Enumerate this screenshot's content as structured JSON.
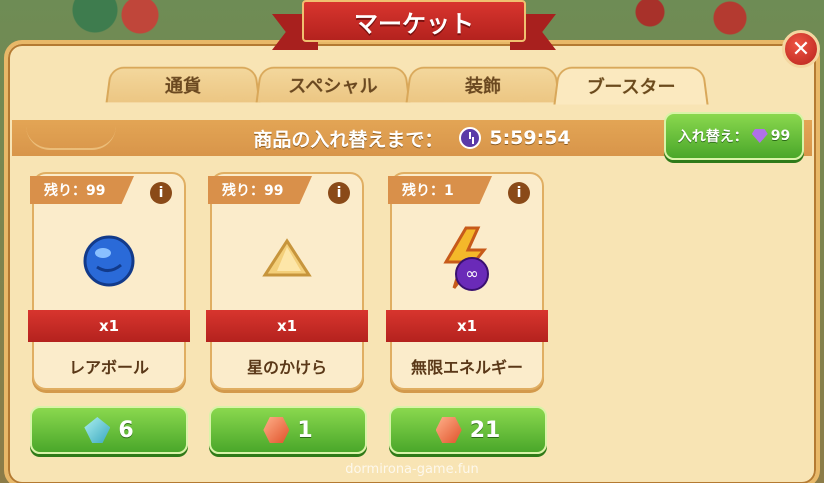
{
  "title": "マーケット",
  "close_label": "✕",
  "tabs": [
    {
      "label": "通貨",
      "active": false
    },
    {
      "label": "スペシャル",
      "active": false
    },
    {
      "label": "装飾",
      "active": false
    },
    {
      "label": "ブースター",
      "active": true
    }
  ],
  "timer": {
    "label": "商品の入れ替えまで：",
    "time": "5:59:54"
  },
  "refresh": {
    "label": "入れ替え：",
    "cost": "99",
    "icon": "purple-gem-icon"
  },
  "items": [
    {
      "remain": "残り：99",
      "qty": "x1",
      "name": "レアボール",
      "price": "6",
      "currency": "blue-crystal",
      "icon": "rare-ball-icon"
    },
    {
      "remain": "残り：99",
      "qty": "x1",
      "name": "星のかけら",
      "price": "1",
      "currency": "orange-gem",
      "icon": "star-fragment-icon"
    },
    {
      "remain": "残り：1",
      "qty": "x1",
      "name": "無限エネルギー",
      "price": "21",
      "currency": "orange-gem",
      "icon": "infinite-energy-icon"
    }
  ],
  "info_label": "i",
  "watermark": "dormirona-game.fun",
  "colors": {
    "ribbon": "#c72a24",
    "panel": "#f8e4b4",
    "button": "#5bb934",
    "timer_bar": "#dc9a4d"
  }
}
